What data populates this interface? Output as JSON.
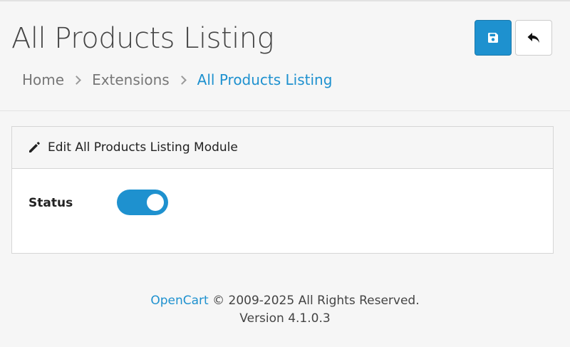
{
  "header": {
    "title": "All Products Listing",
    "breadcrumb": [
      "Home",
      "Extensions",
      "All Products Listing"
    ],
    "save_icon": "save-icon",
    "back_icon": "reply-arrow-icon"
  },
  "card": {
    "title": "Edit All Products Listing Module",
    "title_icon": "pencil-icon",
    "status_label": "Status",
    "status_enabled": true
  },
  "footer": {
    "brand": "OpenCart",
    "copyright": "© 2009-2025 All Rights Reserved.",
    "version": "Version 4.1.0.3"
  },
  "colors": {
    "accent": "#1e91cf",
    "background": "#f6f6f6"
  }
}
